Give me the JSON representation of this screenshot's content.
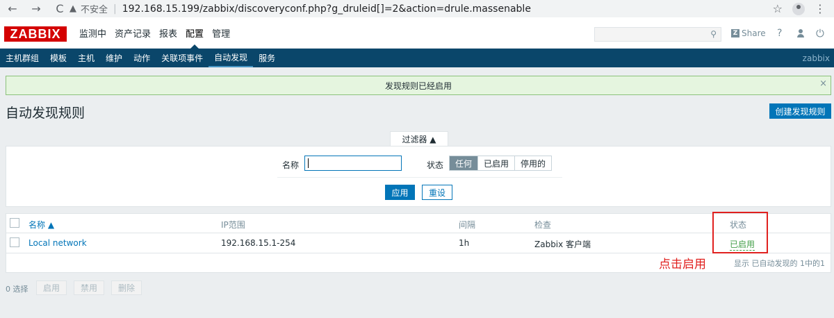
{
  "browser": {
    "back_icon": "←",
    "forward_icon": "→",
    "reload_icon": "C",
    "warn_icon": "▲",
    "insecure_label": "不安全",
    "url": "192.168.15.199/zabbix/discoveryconf.php?g_druleid[]=2&action=drule.massenable",
    "star_icon": "☆",
    "kebab_icon": "⋮"
  },
  "header": {
    "logo": "ZABBIX",
    "menu": [
      {
        "label": "监测中"
      },
      {
        "label": "资产记录"
      },
      {
        "label": "报表"
      },
      {
        "label": "配置"
      },
      {
        "label": "管理"
      }
    ],
    "search_icon": "⚲",
    "share_mark": "Z",
    "share_label": "Share",
    "help_label": "?",
    "power_icon": "⏻"
  },
  "subnav": {
    "items": [
      {
        "label": "主机群组"
      },
      {
        "label": "模板"
      },
      {
        "label": "主机"
      },
      {
        "label": "维护"
      },
      {
        "label": "动作"
      },
      {
        "label": "关联项事件"
      },
      {
        "label": "自动发现"
      },
      {
        "label": "服务"
      }
    ],
    "host_label": "zabbix"
  },
  "message": {
    "text": "发现规则已经启用",
    "close_icon": "×"
  },
  "page": {
    "title": "自动发现规则",
    "create_button": "创建发现规则"
  },
  "filter": {
    "tab_label": "过滤器 ▲",
    "name_label": "名称",
    "name_value": "",
    "status_label": "状态",
    "status_options": [
      "任何",
      "已启用",
      "停用的"
    ],
    "status_selected": "任何",
    "apply_label": "应用",
    "reset_label": "重设"
  },
  "table": {
    "headers": {
      "name": "名称 ▲",
      "ip_range": "IP范围",
      "interval": "间隔",
      "checks": "检查",
      "status": "状态"
    },
    "rows": [
      {
        "name": "Local network",
        "ip_range": "192.168.15.1-254",
        "interval": "1h",
        "checks": "Zabbix 客户端",
        "status": "已启用"
      }
    ],
    "footer": "显示 已自动发现的 1中的1"
  },
  "annotation": {
    "text": "点击启用",
    "color": "#e0201e"
  },
  "actions": {
    "selected_count": "0 选择",
    "enable": "启用",
    "disable": "禁用",
    "delete": "删除"
  }
}
